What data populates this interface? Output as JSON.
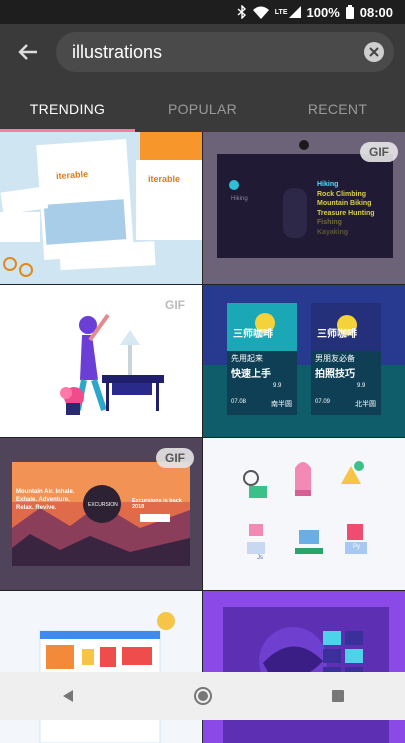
{
  "status": {
    "battery": "100%",
    "time": "08:00",
    "network": "LTE"
  },
  "search": {
    "query": "illustrations"
  },
  "tabs": [
    {
      "label": "TRENDING",
      "active": true
    },
    {
      "label": "POPULAR",
      "active": false
    },
    {
      "label": "RECENT",
      "active": false
    }
  ],
  "colors": {
    "accent": "#ff7aa2",
    "header": "#3a3a3a",
    "status_bar": "#1e1e1e"
  },
  "grid": {
    "gif_badge": "GIF",
    "tiles": [
      {
        "brand": "iterable",
        "brand2": "iterable"
      },
      {
        "menu_title": "Hiking",
        "menu_items": [
          "Hiking",
          "Rock Climbing",
          "Mountain Biking",
          "Treasure Hunting",
          "Fishing",
          "Kayaking"
        ]
      },
      {},
      {
        "poster_left_title": "三师咖啡",
        "poster_left_tagline": "快速上手",
        "poster_left_sub": "先用起来",
        "poster_left_price": "9.9",
        "poster_left_place": "南半圆",
        "poster_left_date": "07.08",
        "poster_right_title": "三师咖啡",
        "poster_right_tagline": "拍照技巧",
        "poster_right_sub": "男朋友必备",
        "poster_right_price": "9.9",
        "poster_right_place": "北半圆",
        "poster_right_date": "07.09"
      },
      {
        "headline": "Mountain Air. Inhale. Exhale. Adventure. Relax. Revive.",
        "seal": "EXCURSION",
        "event": "Excursions is back 2018"
      },
      {
        "icons_row_labels": [
          "Js",
          "Py"
        ]
      },
      {},
      {}
    ]
  },
  "nav": {
    "back": "back-nav-icon",
    "home": "home-nav-icon",
    "recents": "recents-nav-icon"
  }
}
